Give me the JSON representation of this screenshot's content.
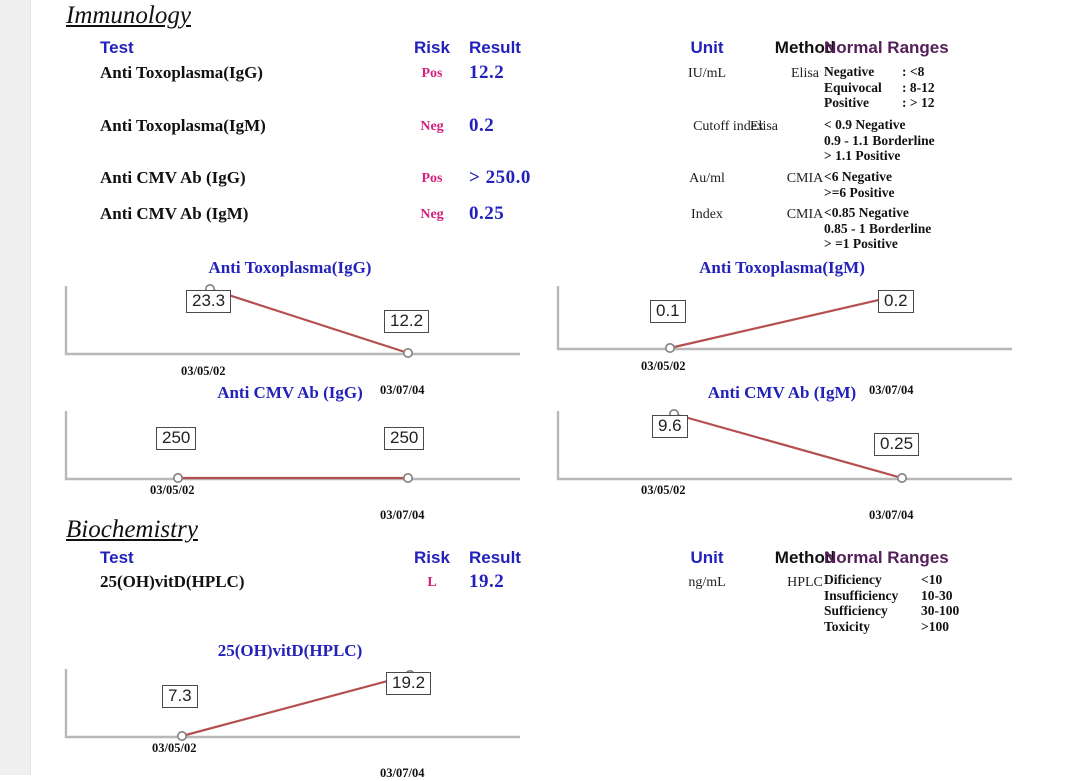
{
  "page": {
    "background": "#ffffff",
    "gutter_color": "#efefef",
    "accent_blue": "#2222bb",
    "accent_pink": "#d6217e",
    "accent_purple": "#55205a",
    "line_color": "#b4504f",
    "axis_color": "#aaaaaa"
  },
  "sections": [
    {
      "title": "Immunology",
      "headers": {
        "test": "Test",
        "risk": "Risk",
        "result": "Result",
        "unit": "Unit",
        "method": "Method",
        "ranges": "Normal Ranges"
      },
      "rows": [
        {
          "test": "Anti Toxoplasma(IgG)",
          "risk": "Pos",
          "result": "12.2",
          "unit": "IU/mL",
          "method": "Elisa",
          "ranges": [
            {
              "label": "Negative",
              "value": ": <8"
            },
            {
              "label": "Equivocal",
              "value": ": 8-12"
            },
            {
              "label": "Positive",
              "value": ": > 12"
            }
          ]
        },
        {
          "test": "Anti Toxoplasma(IgM)",
          "risk": "Neg",
          "result": "0.2",
          "unit": "Cutoff index",
          "method": "Elisa",
          "ranges": [
            {
              "label": "< 0.9 Negative",
              "value": ""
            },
            {
              "label": "0.9 - 1.1 Borderline",
              "value": ""
            },
            {
              "label": "> 1.1 Positive",
              "value": ""
            }
          ]
        },
        {
          "test": "Anti CMV Ab (IgG)",
          "risk": "Pos",
          "result": "> 250.0",
          "unit": "Au/ml",
          "method": "CMIA",
          "ranges": [
            {
              "label": "<6  Negative",
              "value": ""
            },
            {
              "label": ">=6  Positive",
              "value": ""
            }
          ]
        },
        {
          "test": "Anti CMV Ab (IgM)",
          "risk": "Neg",
          "result": "0.25",
          "unit": "Index",
          "method": "CMIA",
          "ranges": [
            {
              "label": "<0.85 Negative",
              "value": ""
            },
            {
              "label": "0.85 - 1 Borderline",
              "value": ""
            },
            {
              "label": "> =1 Positive",
              "value": ""
            }
          ]
        }
      ]
    },
    {
      "title": "Biochemistry",
      "headers": {
        "test": "Test",
        "risk": "Risk",
        "result": "Result",
        "unit": "Unit",
        "method": "Method",
        "ranges": "Normal Ranges"
      },
      "rows": [
        {
          "test": "25(OH)vitD(HPLC)",
          "risk": "L",
          "result": "19.2",
          "unit": "ng/mL",
          "method": "HPLC",
          "ranges": [
            {
              "label": "Dificiency",
              "value": "<10"
            },
            {
              "label": "Insufficiency",
              "value": "10-30"
            },
            {
              "label": "Sufficiency",
              "value": "30-100"
            },
            {
              "label": "Toxicity",
              "value": ">100"
            }
          ]
        }
      ]
    }
  ],
  "chart_data": [
    {
      "type": "line",
      "title": "Anti Toxoplasma(IgG)",
      "x": [
        "03/05/02",
        "03/07/04"
      ],
      "values": [
        23.3,
        12.2
      ],
      "labels": [
        "23.3",
        "12.2"
      ],
      "xlabel": "",
      "ylabel": "",
      "grid": false,
      "legend": "none"
    },
    {
      "type": "line",
      "title": "Anti Toxoplasma(IgM)",
      "x": [
        "03/05/02",
        "03/07/04"
      ],
      "values": [
        0.1,
        0.2
      ],
      "labels": [
        "0.1",
        "0.2"
      ],
      "xlabel": "",
      "ylabel": "",
      "grid": false,
      "legend": "none"
    },
    {
      "type": "line",
      "title": "Anti CMV Ab (IgG)",
      "x": [
        "03/05/02",
        "03/07/04"
      ],
      "values": [
        250,
        250
      ],
      "labels": [
        "250",
        "250"
      ],
      "xlabel": "",
      "ylabel": "",
      "grid": false,
      "legend": "none"
    },
    {
      "type": "line",
      "title": "Anti CMV Ab (IgM)",
      "x": [
        "03/05/02",
        "03/07/04"
      ],
      "values": [
        9.6,
        0.25
      ],
      "labels": [
        "9.6",
        "0.25"
      ],
      "xlabel": "",
      "ylabel": "",
      "grid": false,
      "legend": "none"
    },
    {
      "type": "line",
      "title": "25(OH)vitD(HPLC)",
      "x": [
        "03/05/02",
        "03/07/04"
      ],
      "values": [
        7.3,
        19.2
      ],
      "labels": [
        "7.3",
        "19.2"
      ],
      "xlabel": "",
      "ylabel": "",
      "grid": false,
      "legend": "none"
    }
  ]
}
